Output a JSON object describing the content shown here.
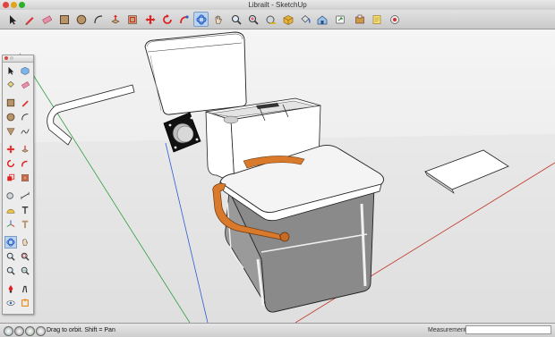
{
  "window": {
    "title": "Librailt - SketchUp"
  },
  "toolbar": {
    "tools": [
      {
        "name": "select-tool",
        "icon": "arrow-icon"
      },
      {
        "name": "line-tool",
        "icon": "pencil-icon"
      },
      {
        "name": "eraser-tool",
        "icon": "eraser-icon"
      },
      {
        "name": "rectangle-tool",
        "icon": "rectangle-icon"
      },
      {
        "name": "circle-tool",
        "icon": "circle-icon"
      },
      {
        "name": "arc-tool",
        "icon": "arc-icon"
      },
      {
        "name": "push-pull-tool",
        "icon": "push-pull-icon"
      },
      {
        "name": "offset-tool",
        "icon": "offset-icon"
      },
      {
        "name": "move-tool",
        "icon": "move-icon"
      },
      {
        "name": "rotate-tool",
        "icon": "rotate-icon"
      },
      {
        "name": "follow-me-tool",
        "icon": "follow-me-icon"
      },
      {
        "name": "orbit-tool",
        "icon": "orbit-icon",
        "selected": true
      },
      {
        "name": "pan-tool",
        "icon": "hand-icon"
      },
      {
        "name": "zoom-tool",
        "icon": "magnifier-icon"
      },
      {
        "name": "zoom-extents-tool",
        "icon": "zoom-extents-icon"
      },
      {
        "name": "tape-measure-tool",
        "icon": "tape-icon"
      },
      {
        "name": "components-tool",
        "icon": "components-icon"
      },
      {
        "name": "paint-bucket-tool",
        "icon": "paint-bucket-icon"
      },
      {
        "name": "warehouse-tool",
        "icon": "warehouse-icon"
      },
      {
        "name": "share-tool",
        "icon": "share-icon"
      }
    ]
  },
  "status": {
    "hint": "Drag to orbit.  Shift = Pan",
    "measurements_label": "Measurements",
    "measurements_value": ""
  },
  "colors": {
    "axis_red": "#c0392b",
    "axis_green": "#2ea043",
    "axis_blue": "#2f5bd8",
    "handle_orange": "#d9792b",
    "body_gray": "#8a8a8a",
    "lid_white": "#f4f4f4",
    "selection_blue": "#bcd3ee"
  }
}
